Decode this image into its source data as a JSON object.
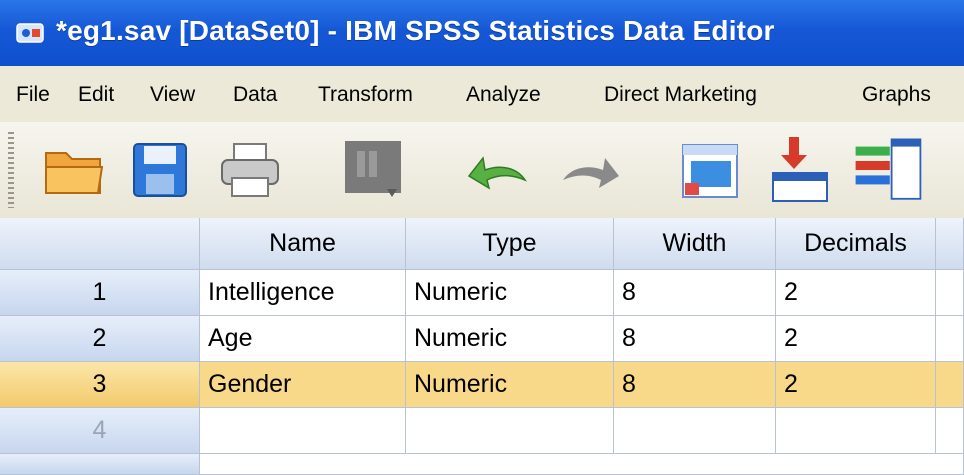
{
  "window": {
    "title": "*eg1.sav [DataSet0] - IBM SPSS Statistics Data Editor"
  },
  "menu": [
    "File",
    "Edit",
    "View",
    "Data",
    "Transform",
    "Analyze",
    "Direct Marketing",
    "Graphs"
  ],
  "toolbar": {
    "icons": [
      "open-folder-icon",
      "save-icon",
      "print-icon",
      "dialog-recall-icon",
      "undo-icon",
      "redo-icon",
      "goto-case-icon",
      "goto-variable-icon",
      "variables-icon"
    ]
  },
  "grid": {
    "columns": [
      "Name",
      "Type",
      "Width",
      "Decimals"
    ],
    "rows": [
      {
        "num": "1",
        "cells": [
          "Intelligence",
          "Numeric",
          "8",
          "2"
        ]
      },
      {
        "num": "2",
        "cells": [
          "Age",
          "Numeric",
          "8",
          "2"
        ]
      },
      {
        "num": "3",
        "cells": [
          "Gender",
          "Numeric",
          "8",
          "2"
        ]
      },
      {
        "num": "4",
        "cells": [
          "",
          "",
          "",
          ""
        ]
      }
    ],
    "selected_row": "3"
  },
  "colors": {
    "titlebar": "#1558d6",
    "selection": "#f8d98a",
    "menubar": "#ece9d8"
  }
}
